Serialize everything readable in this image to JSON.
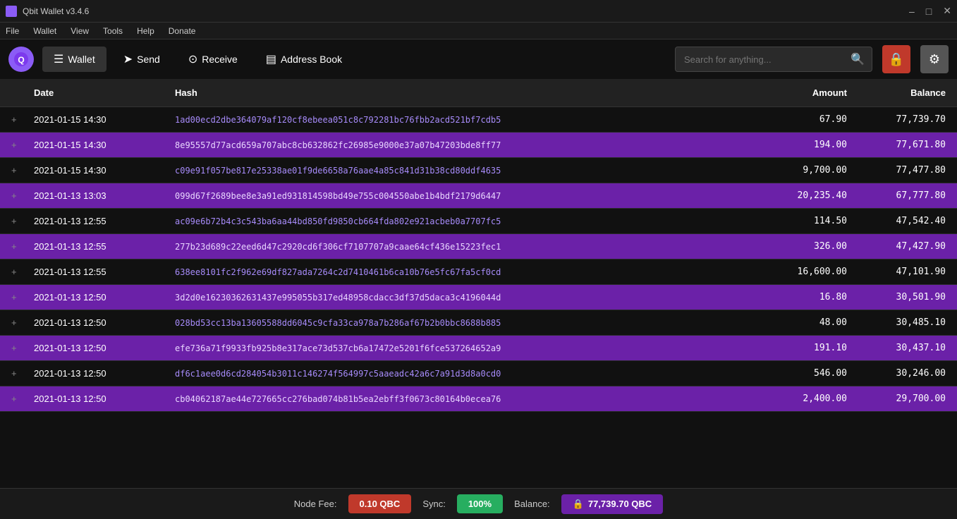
{
  "titleBar": {
    "title": "Qbit Wallet v3.4.6",
    "minimize": "–",
    "maximize": "□",
    "close": "✕"
  },
  "menuBar": {
    "items": [
      "File",
      "Wallet",
      "View",
      "Tools",
      "Help",
      "Donate"
    ]
  },
  "nav": {
    "walletLabel": "Wallet",
    "sendLabel": "Send",
    "receiveLabel": "Receive",
    "addressBookLabel": "Address Book",
    "searchPlaceholder": "Search for anything...",
    "lockIcon": "🔒",
    "settingsIcon": "⚙"
  },
  "table": {
    "headers": [
      "",
      "Date",
      "Hash",
      "Amount",
      "Balance"
    ],
    "rows": [
      {
        "plus": "+",
        "date": "2021-01-15  14:30",
        "hash": "1ad00ecd2dbe364079af120cf8ebeea051c8c792281bc76fbb2acd521bf7cdb5",
        "amount": "67.90",
        "balance": "77,739.70"
      },
      {
        "plus": "+",
        "date": "2021-01-15  14:30",
        "hash": "8e95557d77acd659a707abc8cb632862fc26985e9000e37a07b47203bde8ff77",
        "amount": "194.00",
        "balance": "77,671.80"
      },
      {
        "plus": "+",
        "date": "2021-01-15  14:30",
        "hash": "c09e91f057be817e25338ae01f9de6658a76aae4a85c841d31b38cd80ddf4635",
        "amount": "9,700.00",
        "balance": "77,477.80"
      },
      {
        "plus": "+",
        "date": "2021-01-13  13:03",
        "hash": "099d67f2689bee8e3a91ed931814598bd49e755c004550abe1b4bdf2179d6447",
        "amount": "20,235.40",
        "balance": "67,777.80"
      },
      {
        "plus": "+",
        "date": "2021-01-13  12:55",
        "hash": "ac09e6b72b4c3c543ba6aa44bd850fd9850cb664fda802e921acbeb0a7707fc5",
        "amount": "114.50",
        "balance": "47,542.40"
      },
      {
        "plus": "+",
        "date": "2021-01-13  12:55",
        "hash": "277b23d689c22eed6d47c2920cd6f306cf7107707a9caae64cf436e15223fec1",
        "amount": "326.00",
        "balance": "47,427.90"
      },
      {
        "plus": "+",
        "date": "2021-01-13  12:55",
        "hash": "638ee8101fc2f962e69df827ada7264c2d7410461b6ca10b76e5fc67fa5cf0cd",
        "amount": "16,600.00",
        "balance": "47,101.90"
      },
      {
        "plus": "+",
        "date": "2021-01-13  12:50",
        "hash": "3d2d0e16230362631437e995055b317ed48958cdacc3df37d5daca3c4196044d",
        "amount": "16.80",
        "balance": "30,501.90"
      },
      {
        "plus": "+",
        "date": "2021-01-13  12:50",
        "hash": "028bd53cc13ba13605588dd6045c9cfa33ca978a7b286af67b2b0bbc8688b885",
        "amount": "48.00",
        "balance": "30,485.10"
      },
      {
        "plus": "+",
        "date": "2021-01-13  12:50",
        "hash": "efe736a71f9933fb925b8e317ace73d537cb6a17472e5201f6fce537264652a9",
        "amount": "191.10",
        "balance": "30,437.10"
      },
      {
        "plus": "+",
        "date": "2021-01-13  12:50",
        "hash": "df6c1aee0d6cd284054b3011c146274f564997c5aaeadc42a6c7a91d3d8a0cd0",
        "amount": "546.00",
        "balance": "30,246.00"
      },
      {
        "plus": "+",
        "date": "2021-01-13  12:50",
        "hash": "cb04062187ae44e727665cc276bad074b81b5ea2ebff3f0673c80164b0ecea76",
        "amount": "2,400.00",
        "balance": "29,700.00"
      }
    ]
  },
  "statusBar": {
    "nodeFeeLabel": "Node Fee:",
    "nodeFeeValue": "0.10 QBC",
    "syncLabel": "Sync:",
    "syncValue": "100%",
    "balanceLabel": "Balance:",
    "balanceValue": "77,739.70 QBC",
    "lockIcon": "🔒"
  }
}
